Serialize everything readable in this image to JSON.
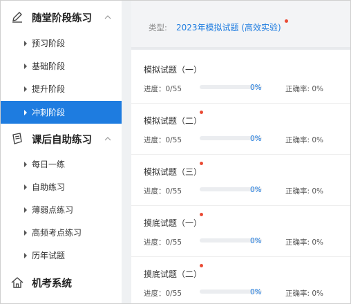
{
  "sidebar": {
    "sections": [
      {
        "title": "随堂阶段练习",
        "icon": "pencil-icon",
        "expanded": true,
        "items": [
          {
            "label": "预习阶段",
            "active": false
          },
          {
            "label": "基础阶段",
            "active": false
          },
          {
            "label": "提升阶段",
            "active": false
          },
          {
            "label": "冲刺阶段",
            "active": true
          }
        ]
      },
      {
        "title": "课后自助练习",
        "icon": "notebook-icon",
        "expanded": true,
        "items": [
          {
            "label": "每日一练",
            "active": false
          },
          {
            "label": "自助练习",
            "active": false
          },
          {
            "label": "薄弱点练习",
            "active": false
          },
          {
            "label": "高频考点练习",
            "active": false
          },
          {
            "label": "历年试题",
            "active": false
          }
        ]
      },
      {
        "title": "机考系统",
        "icon": "house-icon",
        "expanded": false,
        "items": []
      }
    ]
  },
  "main": {
    "type_label": "类型:",
    "type_value": "2023年模拟试题 (高效实验)",
    "exams": [
      {
        "title": "模拟试题（一）",
        "new_dot": false,
        "progress_label": "进度：0/55",
        "progress": 0,
        "percent": "0%",
        "accuracy": "正确率: 0%"
      },
      {
        "title": "模拟试题（二）",
        "new_dot": true,
        "progress_label": "进度：0/55",
        "progress": 0,
        "percent": "0%",
        "accuracy": "正确率: 0%"
      },
      {
        "title": "模拟试题（三）",
        "new_dot": true,
        "progress_label": "进度：0/55",
        "progress": 0,
        "percent": "0%",
        "accuracy": "正确率: 0%"
      },
      {
        "title": "摸底试题（一）",
        "new_dot": true,
        "progress_label": "进度：0/55",
        "progress": 0,
        "percent": "0%",
        "accuracy": "正确率: 0%"
      },
      {
        "title": "摸底试题（二）",
        "new_dot": true,
        "progress_label": "进度：0/55",
        "progress": 0,
        "percent": "0%",
        "accuracy": "正确率: 0%"
      }
    ]
  },
  "colors": {
    "accent": "#1e7ce0",
    "dot": "#ea4b35",
    "band": "#eff1f3"
  }
}
